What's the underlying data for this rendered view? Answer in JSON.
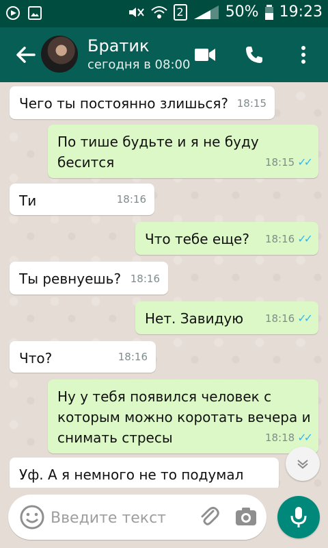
{
  "status_bar": {
    "battery": "50%",
    "time": "19:23",
    "sim": "2"
  },
  "header": {
    "contact_name": "Братик",
    "contact_status": "сегодня в 08:00"
  },
  "messages": [
    {
      "dir": "in",
      "text": "Чего ты постоянно злишься?",
      "time": "18:15"
    },
    {
      "dir": "out",
      "text": "По тише будьте и я не буду бесится",
      "time": "18:15"
    },
    {
      "dir": "in",
      "text": "Ти",
      "time": "18:16"
    },
    {
      "dir": "out",
      "text": "Что тебе еще?",
      "time": "18:16"
    },
    {
      "dir": "in",
      "text": "Ты ревнуешь?",
      "time": "18:16"
    },
    {
      "dir": "out",
      "text": "Нет. Завидую",
      "time": "18:16"
    },
    {
      "dir": "in",
      "text": "Что?",
      "time": "18:16"
    },
    {
      "dir": "out",
      "text": "Ну у тебя появился человек с которым можно коротать вечера и снимать стресы",
      "time": "18:18"
    },
    {
      "dir": "in",
      "text": "Уф. А я немного не то подумал",
      "time": ""
    }
  ],
  "composer": {
    "placeholder": "Введите текст"
  },
  "colors": {
    "header": "#075e54",
    "statusbar": "#004d40",
    "bubble_out": "#dcf8c6",
    "bubble_in": "#ffffff",
    "tick": "#34b7f1",
    "mic": "#00897b"
  },
  "icons": [
    "back-arrow-icon",
    "video-call-icon",
    "phone-icon",
    "more-vert-icon",
    "emoji-icon",
    "attach-icon",
    "camera-icon",
    "mic-icon",
    "chevron-down-icon"
  ]
}
